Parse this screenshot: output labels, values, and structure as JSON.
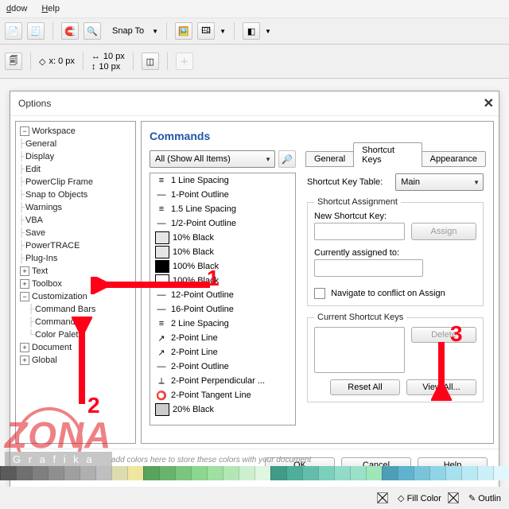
{
  "menu": {
    "window": "dow",
    "help": "Help"
  },
  "snap": {
    "label": "Snap To",
    "x": "0 px",
    "xicon": "x",
    "y_a": "10 px",
    "y_b": "10 px"
  },
  "dialog": {
    "title": "Options",
    "tree": {
      "root": "Workspace",
      "items": [
        "General",
        "Display",
        "Edit",
        "PowerClip Frame",
        "Snap to Objects",
        "Warnings",
        "VBA",
        "Save",
        "PowerTRACE",
        "Plug-Ins"
      ],
      "branches": [
        "Text",
        "Toolbox"
      ],
      "custom": "Customization",
      "custom_children": [
        "Command Bars",
        "Commands",
        "Color Palette"
      ],
      "after": [
        "Document",
        "Global"
      ]
    },
    "commands": {
      "title": "Commands",
      "filter": "All (Show All Items)",
      "list": [
        "1 Line Spacing",
        "1-Point Outline",
        "1.5 Line Spacing",
        "1/2-Point Outline",
        "10% Black",
        "10% Black",
        "100% Black",
        "100% Black",
        "12-Point Outline",
        "16-Point Outline",
        "2 Line Spacing",
        "2-Point Line",
        "2-Point Line",
        "2-Point Outline",
        "2-Point Perpendicular ...",
        "2-Point Tangent Line",
        "20% Black"
      ]
    },
    "tabs": [
      "General",
      "Shortcut Keys",
      "Appearance"
    ],
    "shortcut": {
      "table_label": "Shortcut Key Table:",
      "table_value": "Main",
      "group": "Shortcut Assignment",
      "new_label": "New Shortcut Key:",
      "assign": "Assign",
      "assigned_label": "Currently assigned to:",
      "navigate": "Navigate to conflict on Assign",
      "current_label": "Current Shortcut Keys",
      "delete": "Delete",
      "reset": "Reset All",
      "viewall": "View All..."
    },
    "buttons": {
      "ok": "OK",
      "cancel": "Cancel",
      "help": "Help"
    }
  },
  "annot": {
    "one": "1",
    "two": "2",
    "three": "3"
  },
  "watermark": {
    "brand": "ZONA",
    "sub": "G r a f i k a"
  },
  "footer": {
    "hint": "add colors here to store these colors with your document",
    "fill": "Fill Color",
    "outline": "Outlin"
  },
  "palette": [
    "#5b5b5b",
    "#6f6f6f",
    "#7f7f7f",
    "#8f8f8f",
    "#9f9f9f",
    "#afafaf",
    "#bfbfbf",
    "#dcdcb0",
    "#efe7a0",
    "#59a35c",
    "#69b46d",
    "#7bc57f",
    "#8cd690",
    "#9de0a0",
    "#b2e7b4",
    "#ccf0ce",
    "#dff6e0",
    "#3f9c87",
    "#4fae9a",
    "#62beab",
    "#7bcfbd",
    "#92dbcb",
    "#9be0c9",
    "#9fe7b8",
    "#4d9fb8",
    "#5fb3ce",
    "#79c4da",
    "#90d4e6",
    "#a7e0ef",
    "#b9e9f4",
    "#cbf0f8",
    "#e0f7fd"
  ]
}
